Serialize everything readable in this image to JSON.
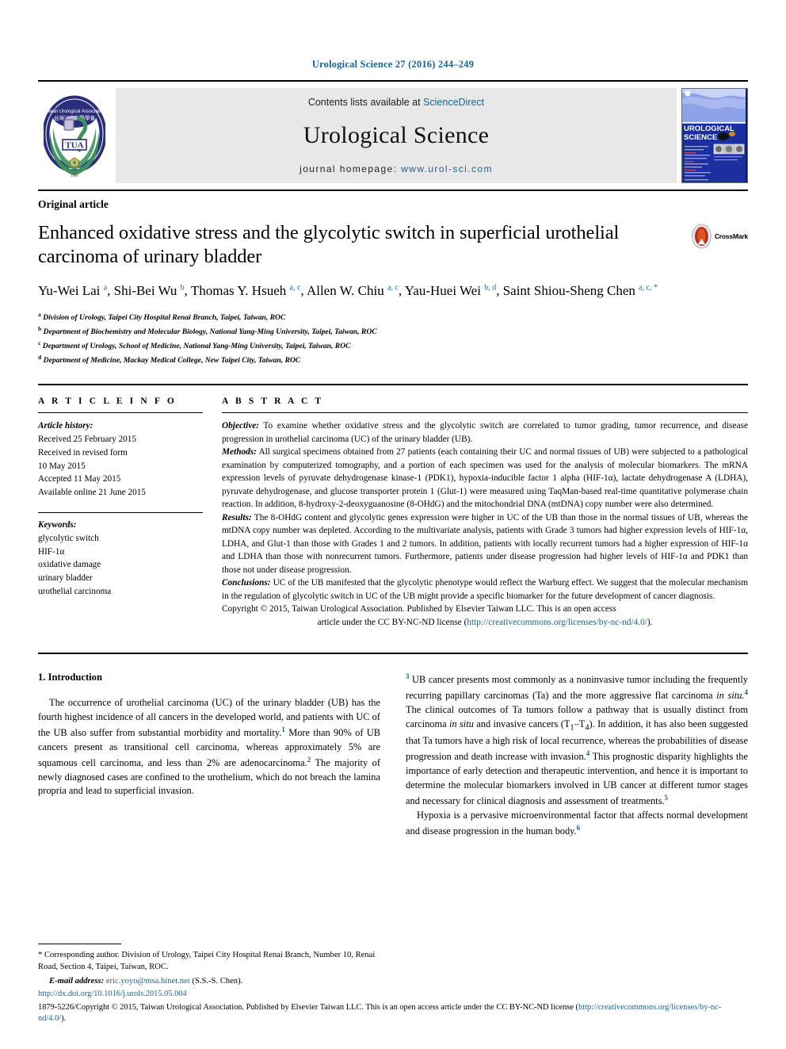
{
  "running_head": "Urological Science 27 (2016) 244–249",
  "masthead": {
    "logo_alt": "Taiwan Urological Association emblem",
    "logo_text": "TUA",
    "contents_line_prefix": "Contents lists available at ",
    "sciencedirect": "ScienceDirect",
    "journal_title": "Urological Science",
    "homepage_label": "journal homepage:",
    "homepage_url": "www.urol-sci.com",
    "cover_title_line1": "UROLOGICAL",
    "cover_title_line2": "SCIENCE"
  },
  "article": {
    "kicker": "Original article",
    "title": "Enhanced oxidative stress and the glycolytic switch in superficial urothelial carcinoma of urinary bladder",
    "crossmark_label": "CrossMark",
    "authors_html": "Yu-Wei Lai <sup>a</sup>, Shi-Bei Wu <sup>b</sup>, Thomas Y. Hsueh <sup>a, c</sup>, Allen W. Chiu <sup>a, c</sup>, Yau-Huei Wei <sup>b, d</sup>, Saint Shiou-Sheng Chen <sup>a, c, *</sup>",
    "affiliations": [
      {
        "mark": "a",
        "text": "Division of Urology, Taipei City Hospital Renai Branch, Taipei, Taiwan, ROC"
      },
      {
        "mark": "b",
        "text": "Department of Biochemistry and Molecular Biology, National Yang-Ming University, Taipei, Taiwan, ROC"
      },
      {
        "mark": "c",
        "text": "Department of Urology, School of Medicine, National Yang-Ming University, Taipei, Taiwan, ROC"
      },
      {
        "mark": "d",
        "text": "Department of Medicine, Mackay Medical College, New Taipei City, Taiwan, ROC"
      }
    ]
  },
  "article_info": {
    "heading": "A R T I C L E  I N F O",
    "history_label": "Article history:",
    "history": [
      "Received 25 February 2015",
      "Received in revised form",
      "10 May 2015",
      "Accepted 11 May 2015",
      "Available online 21 June 2015"
    ],
    "keywords_label": "Keywords:",
    "keywords": [
      "glycolytic switch",
      "HIF-1α",
      "oxidative damage",
      "urinary bladder",
      "urothelial carcinoma"
    ]
  },
  "abstract": {
    "heading": "A B S T R A C T",
    "objective_label": "Objective:",
    "objective_text": "To examine whether oxidative stress and the glycolytic switch are correlated to tumor grading, tumor recurrence, and disease progression in urothelial carcinoma (UC) of the urinary bladder (UB).",
    "methods_label": "Methods:",
    "methods_text": "All surgical specimens obtained from 27 patients (each containing their UC and normal tissues of UB) were subjected to a pathological examination by computerized tomography, and a portion of each specimen was used for the analysis of molecular biomarkers. The mRNA expression levels of pyruvate dehydrogenase kinase-1 (PDK1), hypoxia-inducible factor 1 alpha (HIF-1α), lactate dehydrogenase A (LDHA), pyruvate dehydrogenase, and glucose transporter protein 1 (Glut-1) were measured using TaqMan-based real-time quantitative polymerase chain reaction. In addition, 8-hydroxy-2-deoxyguanosine (8-OHdG) and the mitochondrial DNA (mtDNA) copy number were also determined.",
    "results_label": "Results:",
    "results_text": "The 8-OHdG content and glycolytic genes expression were higher in UC of the UB than those in the normal tissues of UB, whereas the mtDNA copy number was depleted. According to the multivariate analysis, patients with Grade 3 tumors had higher expression levels of HIF-1α, LDHA, and Glut-1 than those with Grades 1 and 2 tumors. In addition, patients with locally recurrent tumors had a higher expression of HIF-1α and LDHA than those with nonrecurrent tumors. Furthermore, patients under disease progression had higher levels of HIF-1α and PDK1 than those not under disease progression.",
    "conclusions_label": "Conclusions:",
    "conclusions_text": "UC of the UB manifested that the glycolytic phenotype would reflect the Warburg effect. We suggest that the molecular mechanism in the regulation of glycolytic switch in UC of the UB might provide a specific biomarker for the future development of cancer diagnosis.",
    "copyright_text": "Copyright © 2015, Taiwan Urological Association. Published by Elsevier Taiwan LLC. This is an open access",
    "license_lead": "article under the CC BY-NC-ND license (",
    "license_url": "http://creativecommons.org/licenses/by-nc-nd/4.0/",
    "license_tail": ")."
  },
  "introduction": {
    "heading": "1.  Introduction",
    "para1_a": "The occurrence of urothelial carcinoma (UC) of the urinary bladder (UB) has the fourth highest incidence of all cancers in the developed world, and patients with UC of the UB also suffer from substantial morbidity and mortality.",
    "ref1": "1",
    "para1_b": " More than 90% of UB cancers present as transitional cell carcinoma, whereas approximately 5% are squamous cell carcinoma, and less than 2% are adenocarcinoma.",
    "ref2": "2",
    "para1_c": " The majority of newly diagnosed cases are confined to the urothelium, which do not breach the lamina propria and lead to superficial invasion.",
    "ref3": "3",
    "para1_d": " UB cancer presents most commonly as a noninvasive tumor including the frequently recurring papillary carcinomas (Ta) and the more aggressive flat carcinoma ",
    "insitu1": "in situ.",
    "ref4": "4",
    "para1_e": " The clinical outcomes of Ta tumors follow a pathway that is usually distinct from carcinoma ",
    "insitu2": "in situ",
    "para1_f": " and invasive cancers (T",
    "sub1": "1",
    "para1_g": "–T",
    "sub4": "4",
    "para1_h": "). In addition, it has also been suggested that Ta tumors have a high risk of local recurrence, whereas the probabilities of disease progression and death increase with invasion.",
    "ref4b": "4",
    "para1_i": " This prognostic disparity highlights the importance of early detection and therapeutic intervention, and hence it is important to determine the molecular biomarkers involved in UB cancer at different tumor stages and necessary for clinical diagnosis and assessment of treatments.",
    "ref5": "5",
    "para2_a": "Hypoxia is a pervasive microenvironmental factor that affects normal development and disease progression in the human body.",
    "ref6": "6"
  },
  "footnote": {
    "star": "*",
    "corresponding": " Corresponding author. Division of Urology, Taipei City Hospital Renai Branch, Number 10, Renai Road, Section 4, Taipei, Taiwan, ROC.",
    "email_label": "E-mail address:",
    "email": "eric.yoyo@msa.hinet.net",
    "email_suffix": " (S.S.-S. Chen)."
  },
  "page_footer": {
    "doi": "http://dx.doi.org/10.1016/j.urols.2015.05.004",
    "issn_copyright": "1879-5226/Copyright © 2015, Taiwan Urological Association. Published by Elsevier Taiwan LLC. This is an open access article under the CC BY-NC-ND license (",
    "license_url": "http://creativecommons.org/licenses/by-nc-nd/4.0/",
    "license_tail": ")."
  },
  "colors": {
    "link": "#1a6496",
    "banner_bg": "#e8e8e8",
    "rule": "#000000"
  }
}
